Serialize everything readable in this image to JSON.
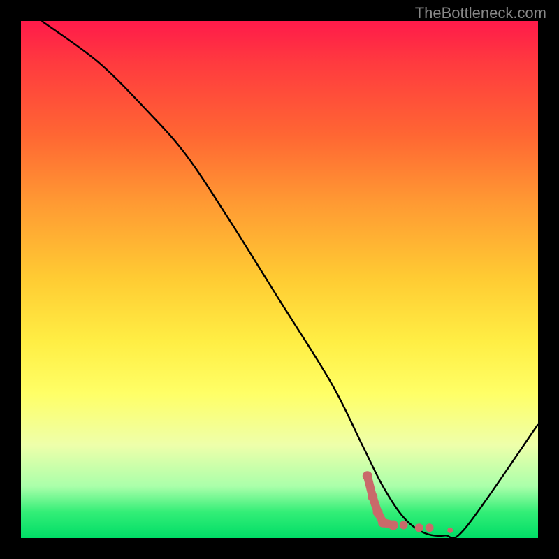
{
  "watermark": "TheBottleneck.com",
  "chart_data": {
    "type": "line",
    "title": "",
    "xlabel": "",
    "ylabel": "",
    "xlim": [
      0,
      100
    ],
    "ylim": [
      0,
      100
    ],
    "series": [
      {
        "name": "curve",
        "x": [
          4,
          15,
          25,
          32,
          40,
          50,
          60,
          66,
          70,
          74,
          78,
          82,
          86,
          100
        ],
        "y": [
          100,
          92,
          82,
          74,
          62,
          46,
          30,
          18,
          10,
          4,
          1,
          0.5,
          2,
          22
        ]
      }
    ],
    "markers": {
      "name": "highlight-cluster",
      "color": "#c96a6a",
      "points": [
        {
          "x": 67,
          "y": 12
        },
        {
          "x": 68,
          "y": 8
        },
        {
          "x": 69,
          "y": 5
        },
        {
          "x": 70,
          "y": 3
        },
        {
          "x": 72,
          "y": 2.5
        },
        {
          "x": 74,
          "y": 2.5
        },
        {
          "x": 77,
          "y": 2
        },
        {
          "x": 79,
          "y": 2
        },
        {
          "x": 83,
          "y": 1.5
        }
      ]
    },
    "gradient_colors": {
      "top": "#ff1a4a",
      "mid": "#ffee44",
      "bottom": "#00dd66"
    }
  }
}
